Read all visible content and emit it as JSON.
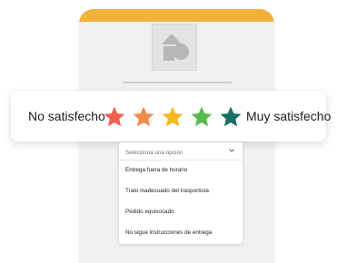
{
  "rating": {
    "left_label": "No satisfecho",
    "right_label": "Muy satisfecho",
    "stars": [
      {
        "color": "#f0614f"
      },
      {
        "color": "#f48a4a"
      },
      {
        "color": "#f6b81f"
      },
      {
        "color": "#59b94f"
      },
      {
        "color": "#176e62"
      }
    ]
  },
  "phone": {
    "accent_color": "#f3b13c",
    "image_icon": "image-placeholder-icon"
  },
  "dropdown": {
    "placeholder": "Selecciona una opción",
    "options": [
      "Entrega fuera de horario",
      "Trato inadecuado del trasportista",
      "Pedido equivocado",
      "No sigue instrucciones de entrega"
    ]
  }
}
